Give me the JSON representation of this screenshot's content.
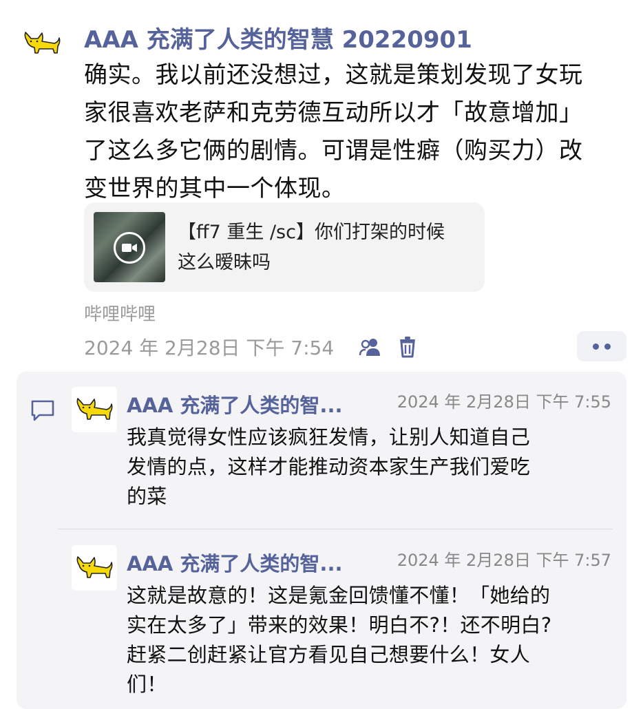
{
  "post": {
    "author": "AAA 充满了人类的智慧 20220901",
    "text_lines": [
      "确实。我以前还没想过，这就是策划发现了女玩",
      "家很喜欢老萨和克劳德互动所以才「故意增加」",
      "了这么多它俩的剧情。可谓是性癖（购买力）改",
      "变世界的其中一个体现。"
    ],
    "link_card": {
      "title_lines": [
        "【ff7 重生 /sc】你们打架的时候",
        "这么暧昧吗"
      ],
      "thumb_icon": "video-camera-icon"
    },
    "source": "哔哩哔哩",
    "timestamp": "2024 年 2月28日  下午 7:54",
    "actions": {
      "visibility_icon": "people-icon",
      "delete_icon": "trash-icon",
      "more_icon": "more-dots-icon"
    }
  },
  "comments": [
    {
      "author": "AAA 充满了人类的智...",
      "time": "2024 年 2月28日  下午 7:55",
      "text_lines": [
        "我真觉得女性应该疯狂发情，让别人知道自己",
        "发情的点，这样才能推动资本家生产我们爱吃",
        "的菜"
      ]
    },
    {
      "author": "AAA 充满了人类的智...",
      "time": "2024 年 2月28日  下午 7:57",
      "text_lines": [
        "这就是故意的！这是氪金回馈懂不懂！「她给的",
        "实在太多了」带来的效果！明白不?！还不明白?",
        "赶紧二创赶紧让官方看见自己想要什么！女人",
        "们！"
      ]
    }
  ],
  "icons": {
    "comment_icon": "comment-bubble-icon",
    "avatar_icon": "yellow-cat-avatar"
  },
  "colors": {
    "accent": "#55639a",
    "muted": "#9a9a9a",
    "comment_bg": "#f4f4f6",
    "avatar_yellow": "#f5d90a"
  }
}
